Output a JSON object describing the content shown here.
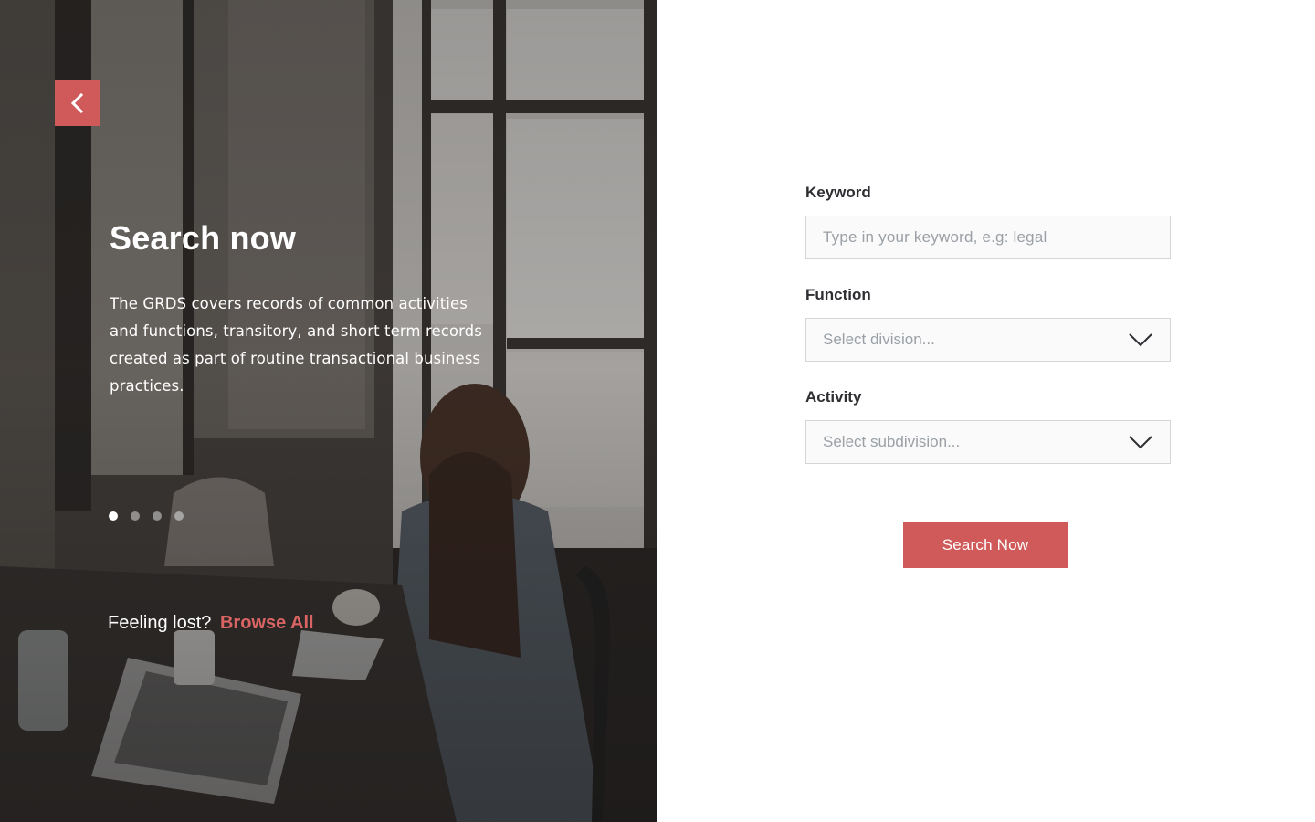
{
  "hero": {
    "title": "Search now",
    "description": "The GRDS covers records of common activities and functions, transitory, and short term records created as part of routine transactional business practices.",
    "slides": [
      {
        "active": true
      },
      {
        "active": false
      },
      {
        "active": false
      },
      {
        "active": false
      }
    ],
    "feeling_lost": "Feeling lost?",
    "browse_all": "Browse All",
    "icons": {
      "back": "chevron-left-icon"
    }
  },
  "form": {
    "keyword": {
      "label": "Keyword",
      "placeholder": "Type in your keyword, e.g: legal"
    },
    "function": {
      "label": "Function",
      "placeholder": "Select division..."
    },
    "activity": {
      "label": "Activity",
      "placeholder": "Select subdivision..."
    },
    "submit_label": "Search Now"
  },
  "colors": {
    "accent": "#d05a5a",
    "link": "#d96464",
    "label": "#2e2e33",
    "placeholder": "#9aa0a6",
    "input_border": "#d6d6d6"
  }
}
